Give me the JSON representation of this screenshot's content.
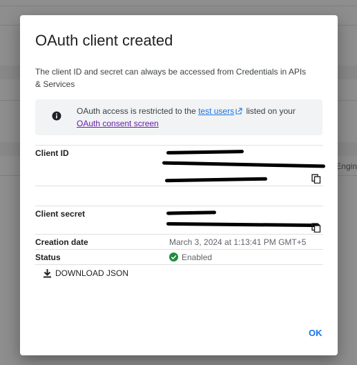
{
  "background": {
    "partial_text": "Engin"
  },
  "dialog": {
    "title": "OAuth client created",
    "subtitle": "The client ID and secret can always be accessed from Credentials in APIs & Services",
    "notice": {
      "icon": "info-icon",
      "text_before": "OAuth access is restricted to the ",
      "link_test_users": "test users",
      "text_after": " listed on your",
      "link_consent": "OAuth consent screen"
    },
    "fields": {
      "client_id_label": "Client ID",
      "client_secret_label": "Client secret",
      "creation_date_label": "Creation date",
      "creation_date_value": "March 3, 2024 at 1:13:41 PM GMT+5",
      "status_label": "Status",
      "status_value": "Enabled"
    },
    "download_label": "DOWNLOAD JSON",
    "ok_label": "OK"
  },
  "colors": {
    "accent": "#1a73e8",
    "visited_link": "#681da8",
    "enabled_green": "#1e8e3e",
    "scrim": "#8e8e8e"
  }
}
